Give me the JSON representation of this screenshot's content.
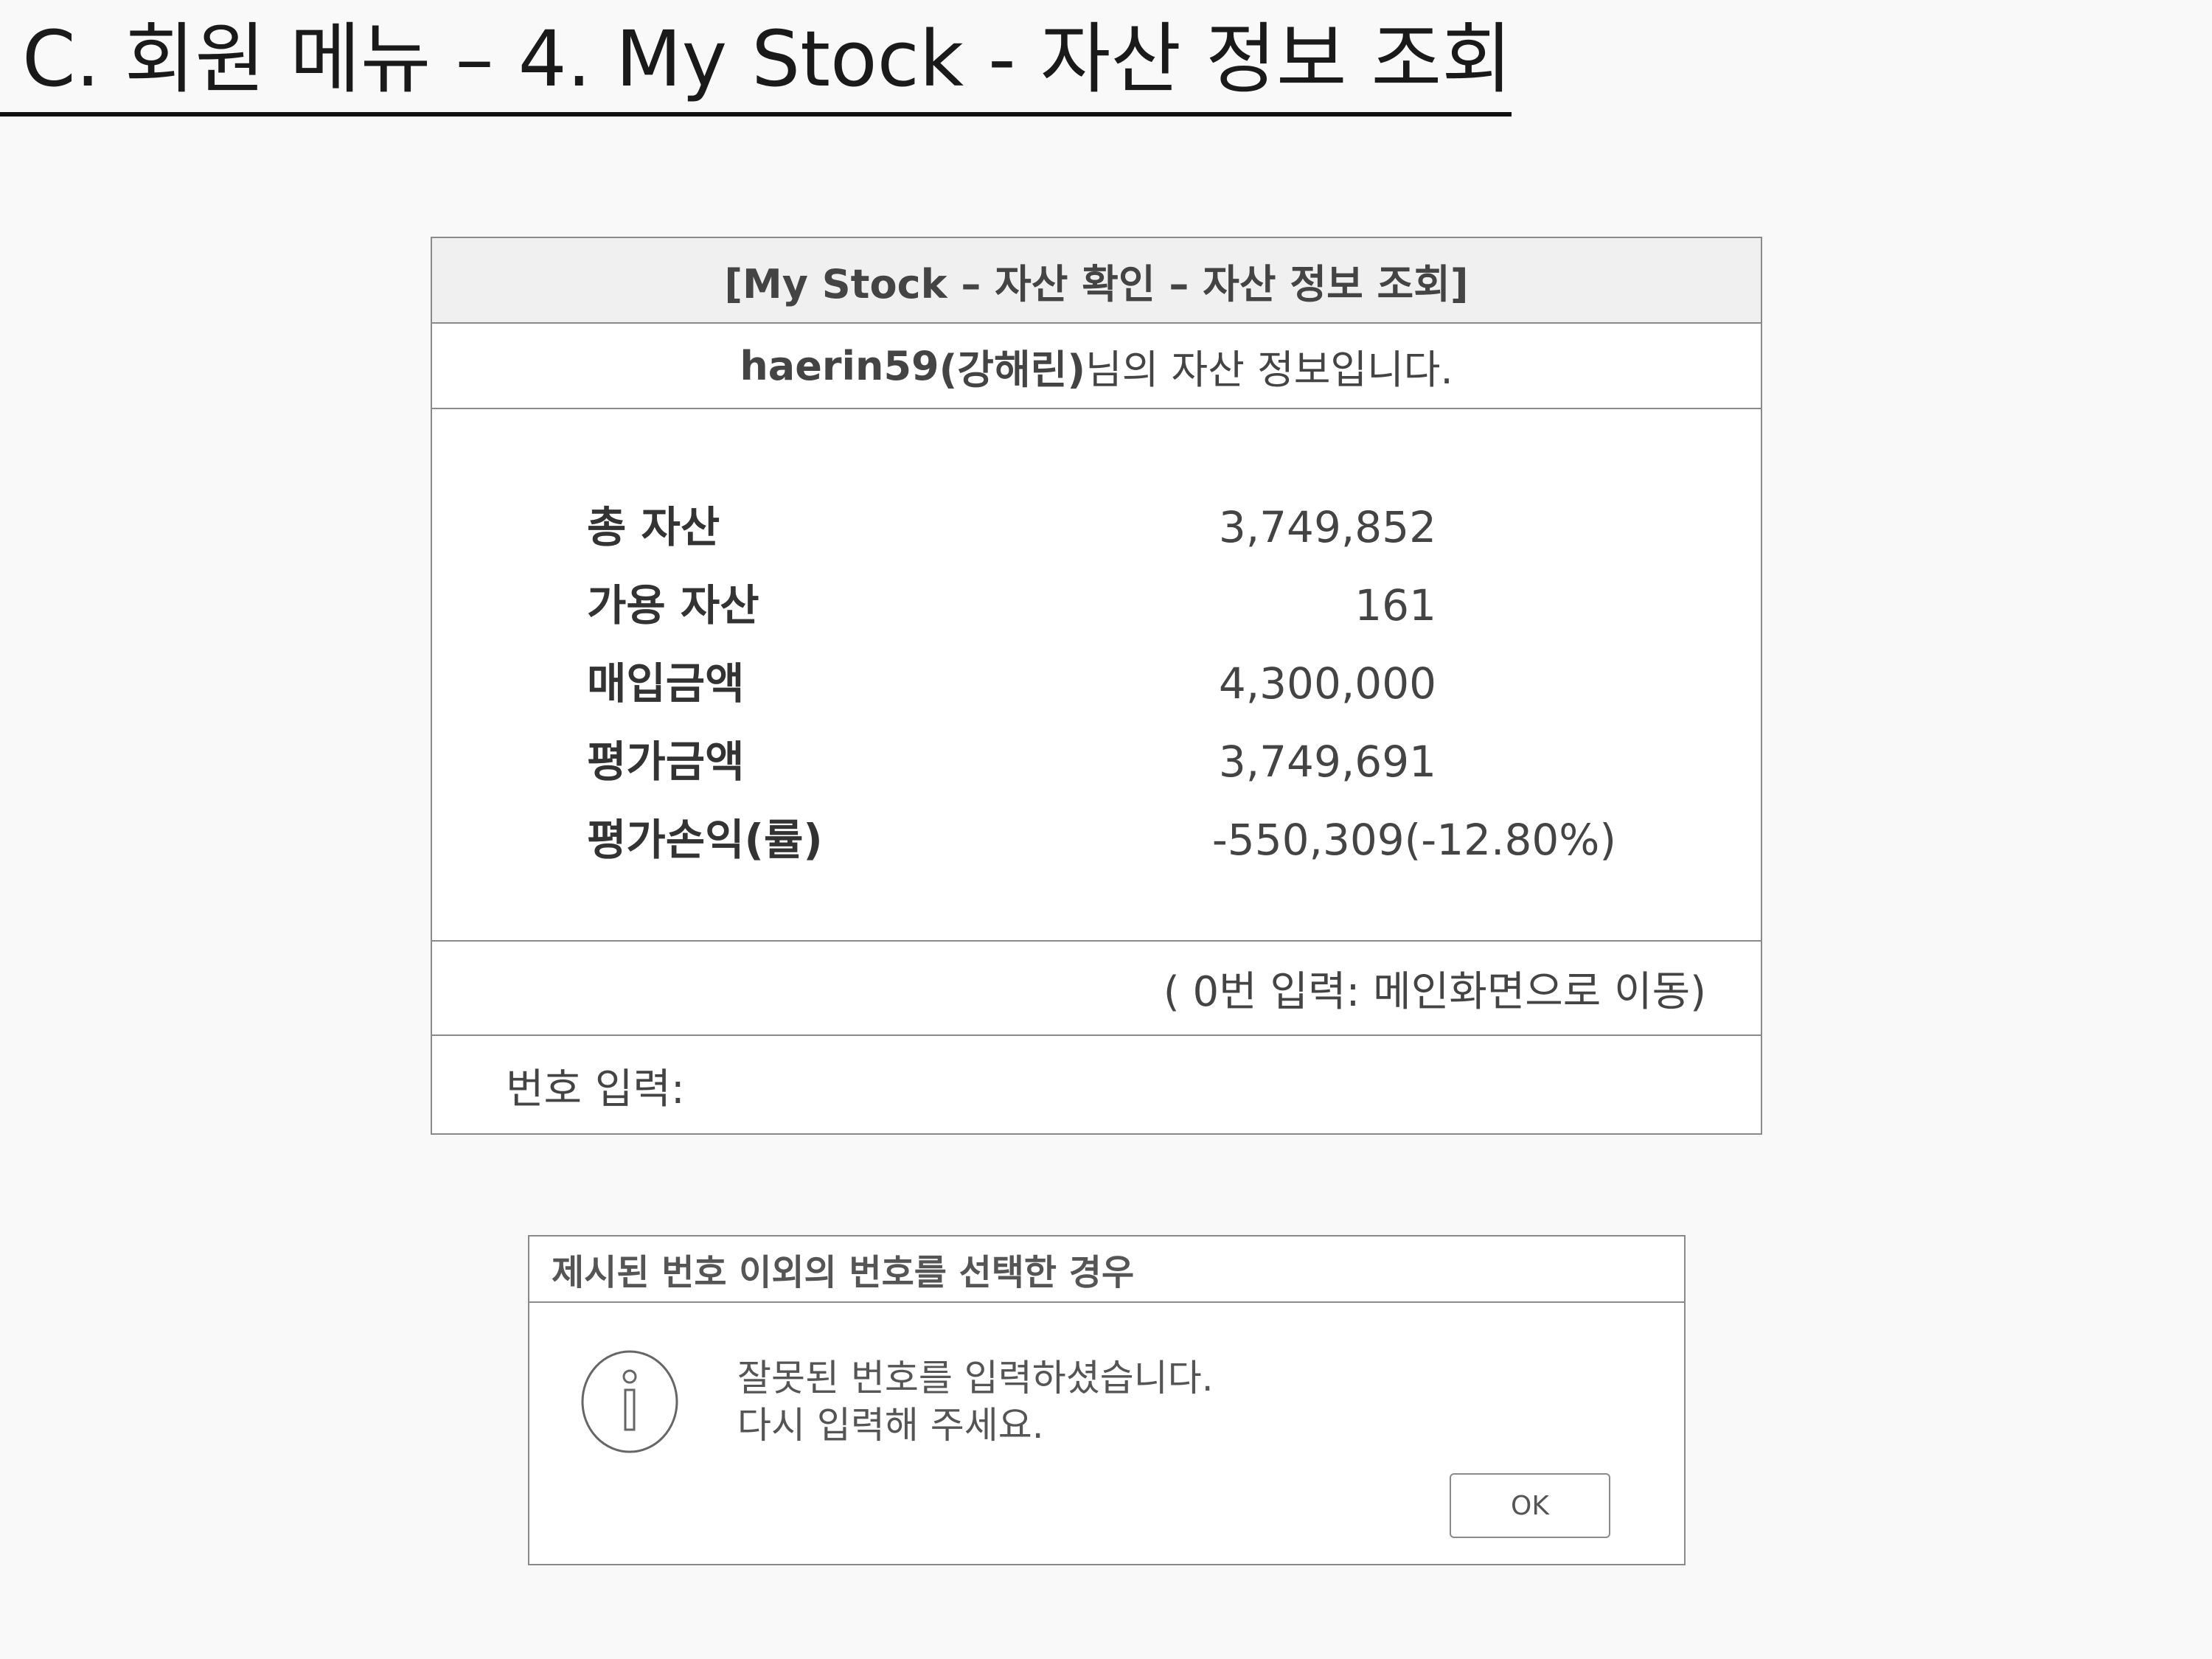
{
  "page": {
    "title": "C. 회원 메뉴 – 4. My Stock - 자산 정보 조회"
  },
  "window": {
    "title": "[My Stock – 자산 확인 – 자산 정보 조회]",
    "greeting": {
      "user_id": "haerin59",
      "user_name": "(강해린)",
      "suffix": "님의 자산 정보입니다."
    },
    "assets": [
      {
        "label": "총 자산",
        "value": "3,749,852"
      },
      {
        "label": "가용 자산",
        "value": "161"
      },
      {
        "label": "매입금액",
        "value": "4,300,000"
      },
      {
        "label": "평가금액",
        "value": "3,749,691"
      },
      {
        "label": "평가손익(률)",
        "value": "-550,309(-12.80%)"
      }
    ],
    "hint": "( 0번 입력: 메인화면으로 이동)",
    "prompt_label": "번호 입력:"
  },
  "dialog": {
    "title": "제시된 번호 이외의 번호를 선택한 경우",
    "message_line1": "잘못된 번호를 입력하셨습니다.",
    "message_line2": "다시 입력해 주세요.",
    "ok_label": "OK",
    "icon": "info-icon"
  }
}
